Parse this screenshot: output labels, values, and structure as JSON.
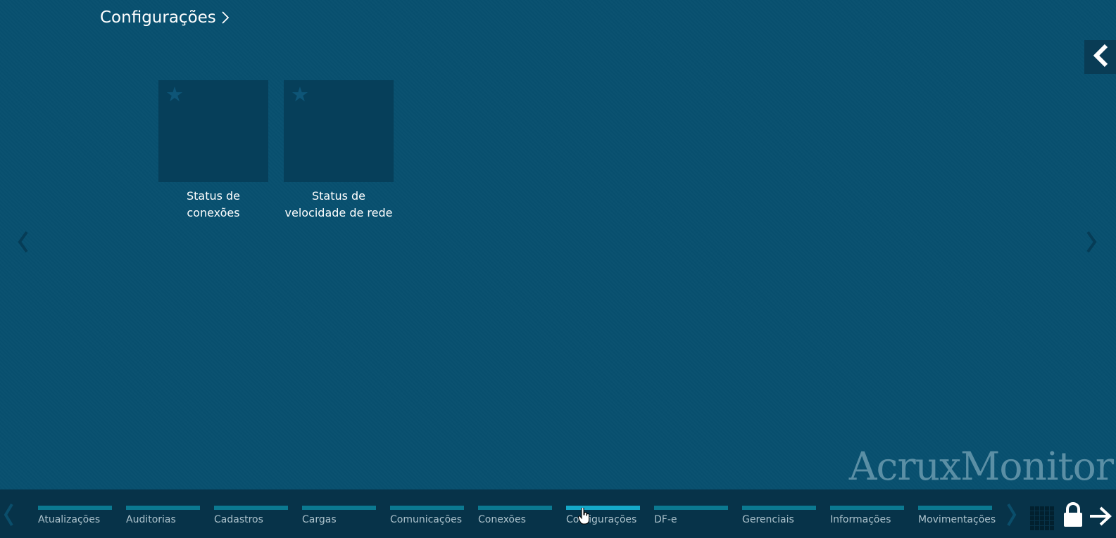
{
  "header": {
    "title": "Configurações"
  },
  "tiles": [
    {
      "label": "Status de conexões"
    },
    {
      "label": "Status de velocidade de rede"
    }
  ],
  "brand": {
    "name": "AcruxMonitor"
  },
  "bottom_nav": {
    "tabs": [
      {
        "label": "Atualizações",
        "active": false
      },
      {
        "label": "Auditorias",
        "active": false
      },
      {
        "label": "Cadastros",
        "active": false
      },
      {
        "label": "Cargas",
        "active": false
      },
      {
        "label": "Comunicações",
        "active": false
      },
      {
        "label": "Conexões",
        "active": false
      },
      {
        "label": "Configurações",
        "active": true
      },
      {
        "label": "DF-e",
        "active": false
      },
      {
        "label": "Gerenciais",
        "active": false
      },
      {
        "label": "Informações",
        "active": false
      },
      {
        "label": "Movimentações",
        "active": false
      }
    ]
  },
  "icons": {
    "title_chevron": "chevron-right-icon",
    "collapse": "chevron-left-icon",
    "tile_star": "star-icon",
    "grid": "grid-icon",
    "lock": "lock-icon",
    "exit": "arrow-right-icon"
  },
  "colors": {
    "background": "#08506f",
    "tile": "#063f5a",
    "bottom_bar": "#073349",
    "tab_bar": "#0b7991",
    "tab_bar_active": "#15a9c9",
    "brand": "#5b8fa5"
  }
}
